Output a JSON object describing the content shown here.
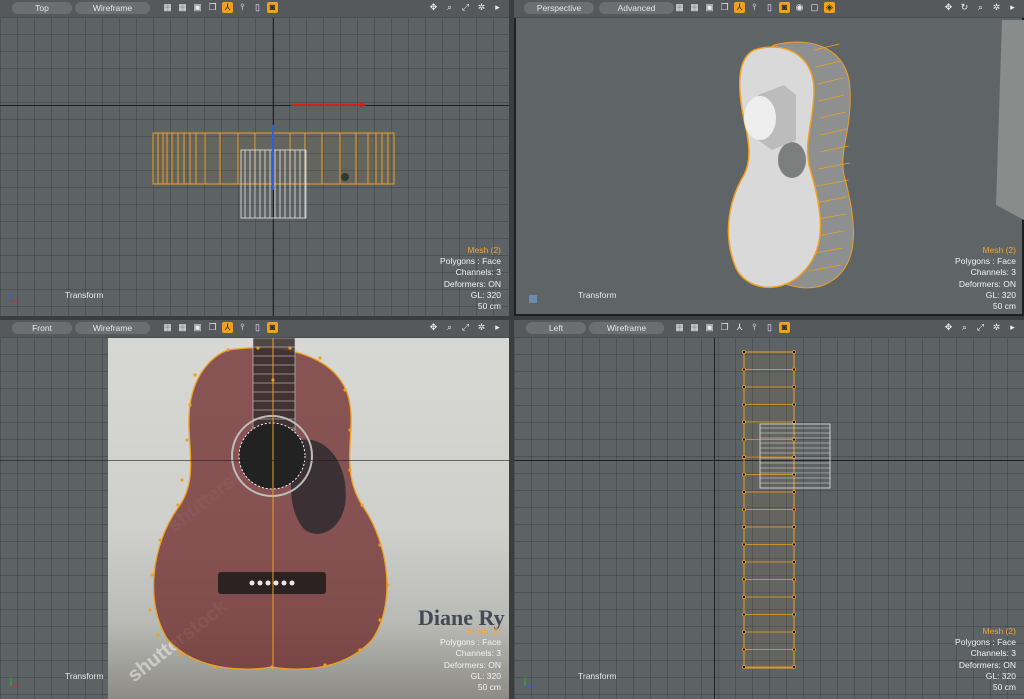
{
  "colors": {
    "viewport_bg": "#5d6264",
    "selection": "#f0a020",
    "mesh_label": "#f3a43a",
    "axis_x": "#d02020",
    "axis_z": "#2f5fe0"
  },
  "toolbar_icons": [
    "move-view-icon",
    "zoom-icon",
    "fit-icon",
    "gear-icon",
    "play-icon"
  ],
  "viewports": {
    "top": {
      "view": "Top",
      "shading": "Wireframe",
      "transform": "Transform",
      "info": {
        "mesh": "Mesh (2)",
        "polygons": "Polygons : Face",
        "channels": "Channels: 3",
        "deformers": "Deformers: ON",
        "gl": "GL: 320",
        "scale": "50 cm"
      }
    },
    "perspective": {
      "view": "Perspective",
      "shading": "Advanced",
      "transform": "Transform",
      "info": {
        "mesh": "Mesh (2)",
        "polygons": "Polygons : Face",
        "channels": "Channels: 3",
        "deformers": "Deformers: ON",
        "gl": "GL: 320",
        "scale": "50 cm"
      }
    },
    "front": {
      "view": "Front",
      "shading": "Wireframe",
      "transform": "Transform",
      "photo_text": "Diane Ry",
      "watermark": "shutterstock",
      "info": {
        "mesh": "Mesh (2)",
        "polygons": "Polygons : Face",
        "channels": "Channels: 3",
        "deformers": "Deformers: ON",
        "gl": "GL: 320",
        "scale": "50 cm"
      }
    },
    "left": {
      "view": "Left",
      "shading": "Wireframe",
      "transform": "Transform",
      "info": {
        "mesh": "Mesh (2)",
        "polygons": "Polygons : Face",
        "channels": "Channels: 3",
        "deformers": "Deformers: ON",
        "gl": "GL: 320",
        "scale": "50 cm"
      }
    }
  }
}
